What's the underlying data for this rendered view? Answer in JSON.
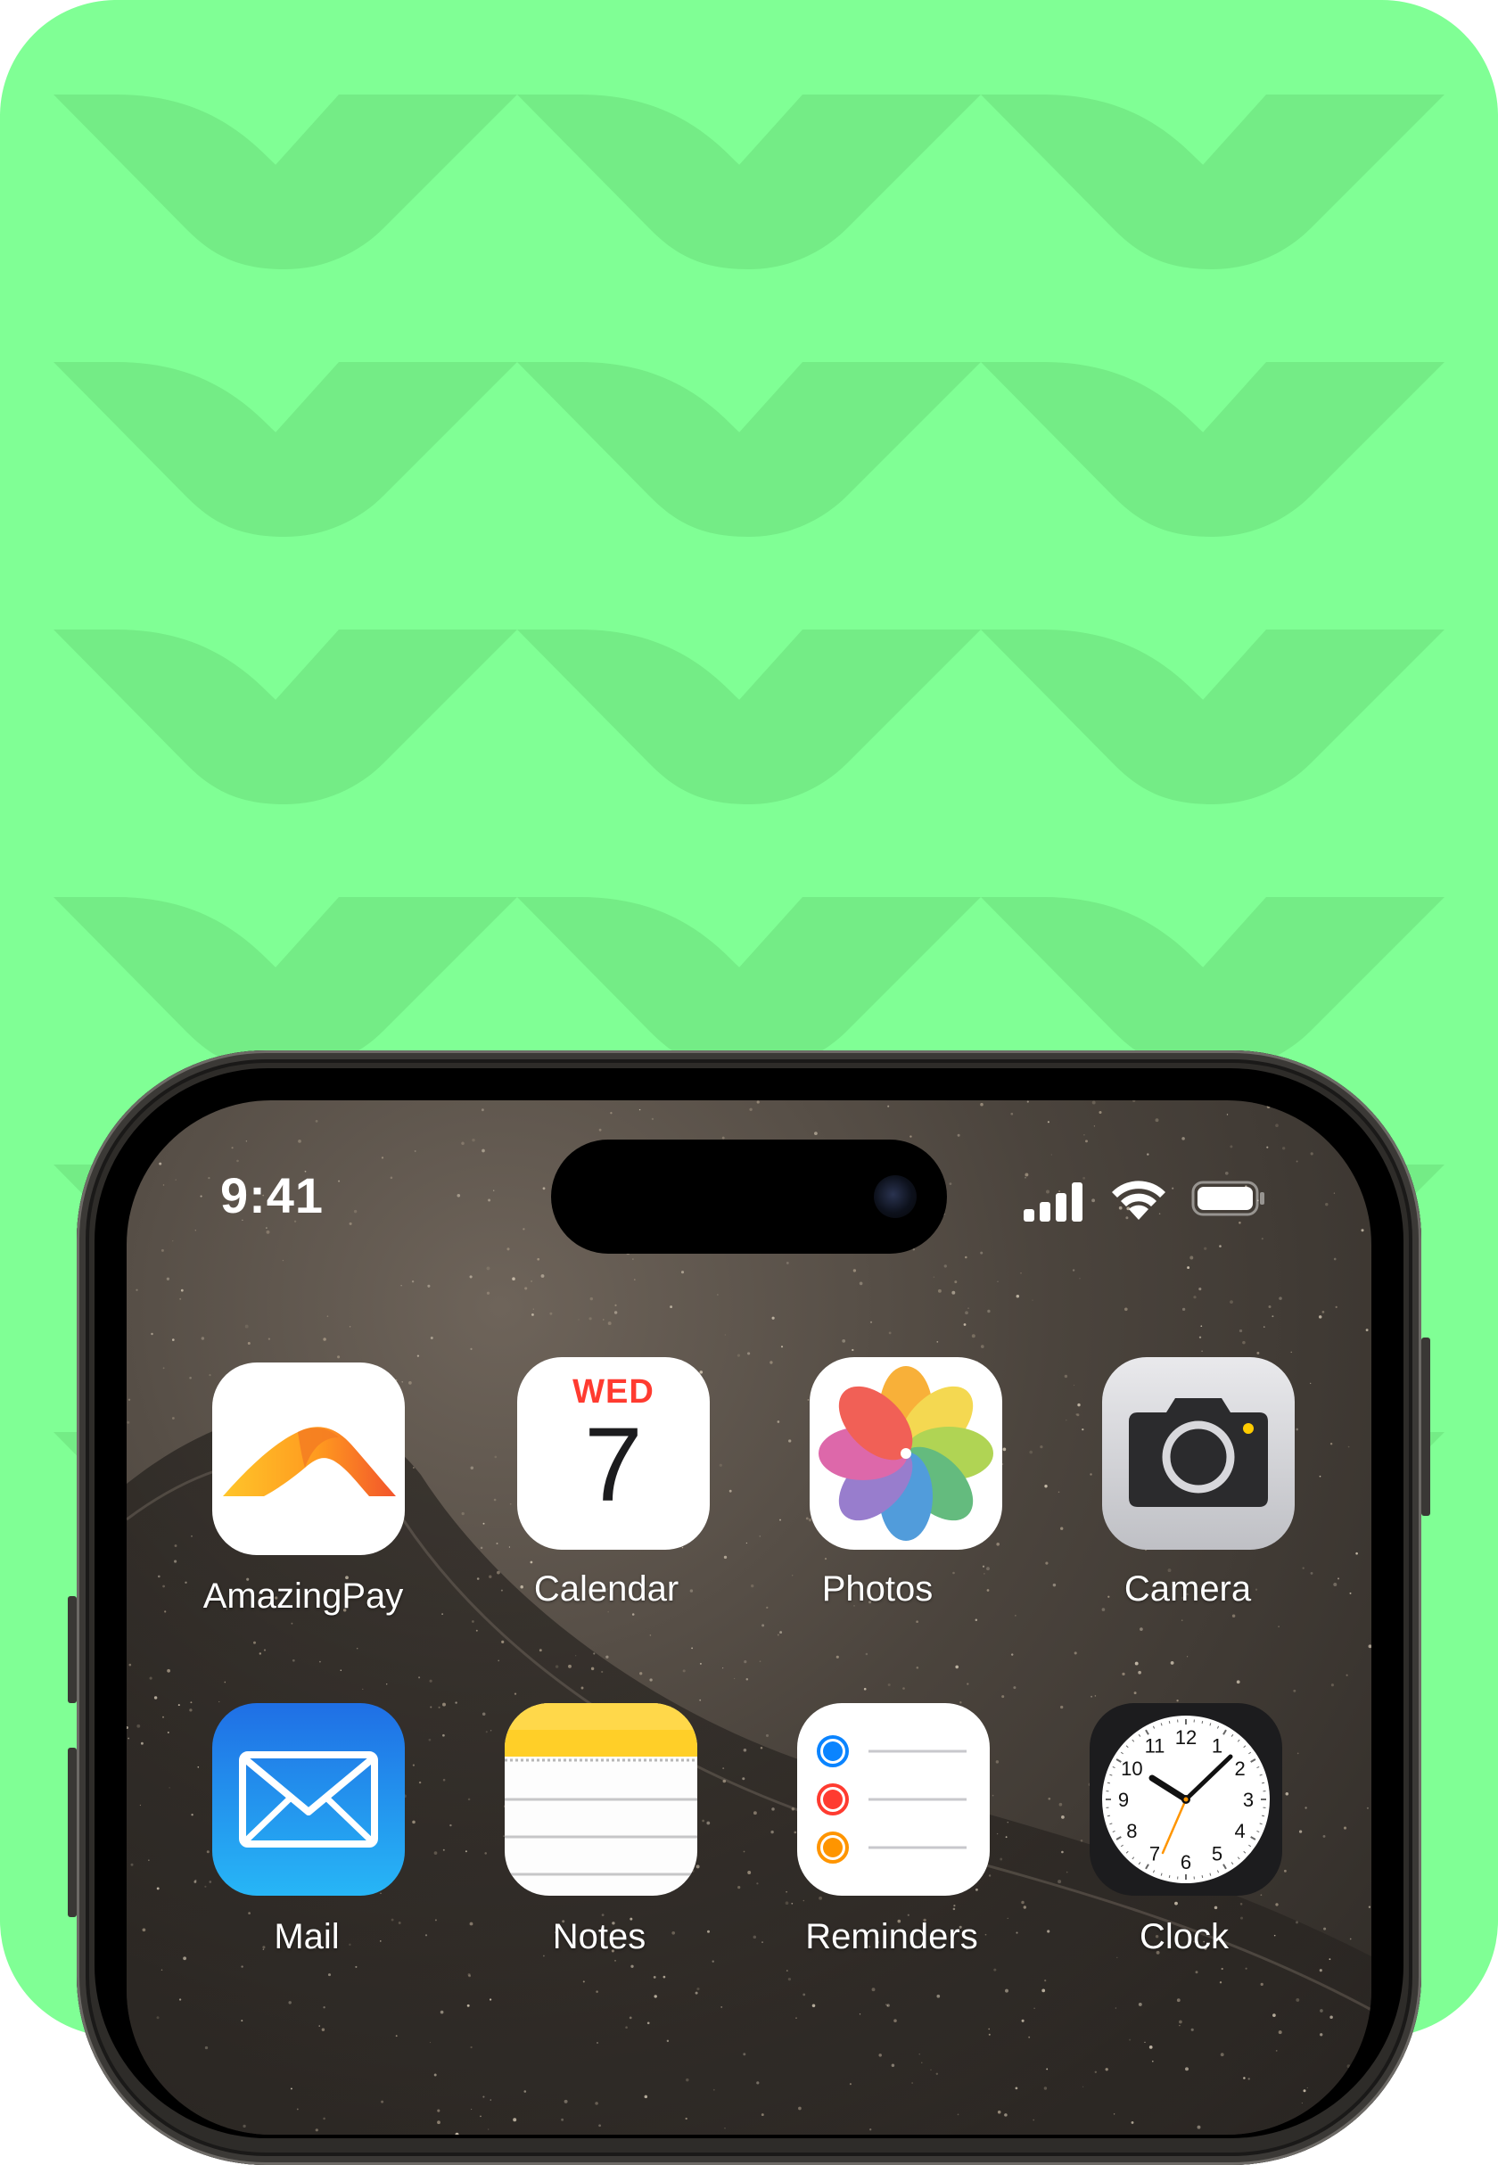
{
  "status_bar": {
    "time": "9:41"
  },
  "apps": [
    {
      "label": "AmazingPay",
      "icon": "amazingpay-icon"
    },
    {
      "label": "Calendar",
      "icon": "calendar-icon",
      "day": "WED",
      "date": "7"
    },
    {
      "label": "Photos",
      "icon": "photos-icon"
    },
    {
      "label": "Camera",
      "icon": "camera-icon"
    },
    {
      "label": "Mail",
      "icon": "mail-icon"
    },
    {
      "label": "Notes",
      "icon": "notes-icon"
    },
    {
      "label": "Reminders",
      "icon": "reminders-icon"
    },
    {
      "label": "Clock",
      "icon": "clock-icon",
      "numerals": [
        "12",
        "1",
        "2",
        "3",
        "4",
        "5",
        "6",
        "7",
        "8",
        "9",
        "10",
        "11"
      ]
    }
  ],
  "colors": {
    "background": "#80ff95",
    "pattern": "#74ec86",
    "calendar_red": "#ff3b30",
    "mail_blue": "#1e90ff",
    "notes_yellow": "#ffd60a",
    "clock_second_hand": "#ff9500"
  }
}
